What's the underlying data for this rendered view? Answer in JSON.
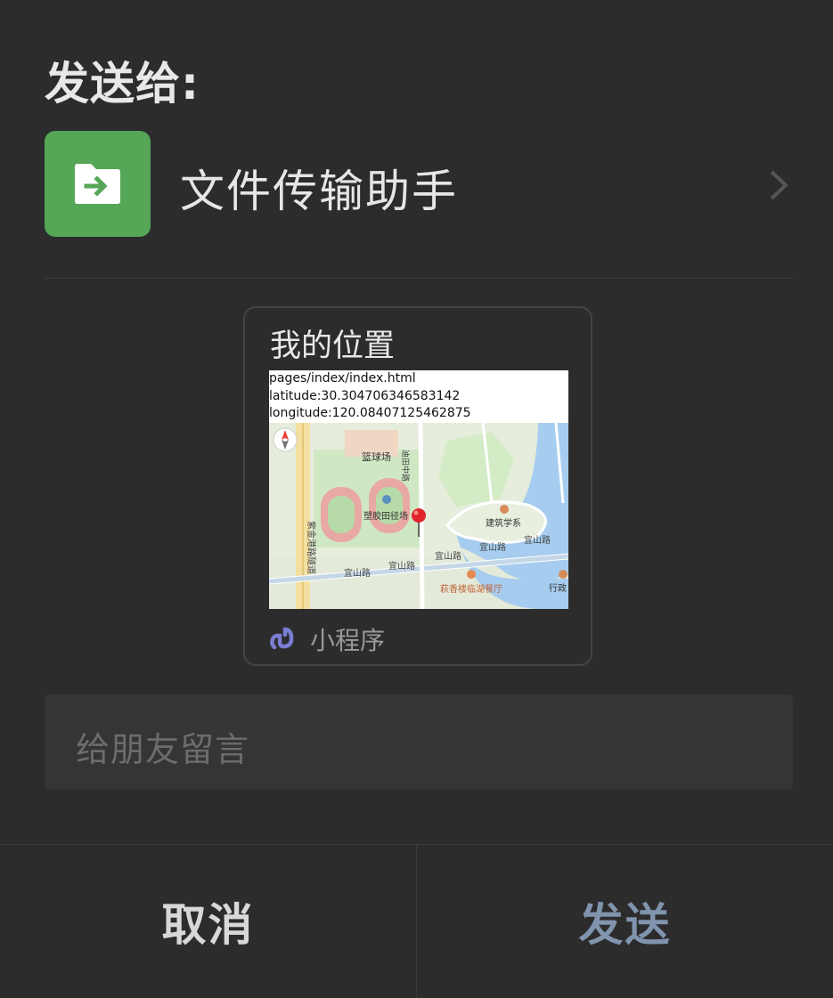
{
  "header": {
    "title": "发送给:"
  },
  "contact": {
    "name": "文件传输助手",
    "icon": "folder-arrow-icon",
    "avatar_color": "#55a656"
  },
  "card": {
    "title": "我的位置",
    "preview_lines": [
      "pages/index/index.html",
      "latitude:30.304706346583142",
      "longitude:120.08407125462875"
    ],
    "map_labels": {
      "basketball": "篮球场",
      "track": "塑胶田径场",
      "architecture": "建筑学系",
      "restaurant": "萩香楼临湖餐厅",
      "road_yishan_1": "宜山路",
      "road_yishan_2": "宜山路",
      "road_yishan_3": "宜山路",
      "road_yishan_4": "宜山路",
      "road_yishan_5": "宜山路",
      "admin": "行政",
      "zijin": "紫金港路隧道",
      "vertical_road": "迪田中路"
    },
    "footer_label": "小程序",
    "footer_icon": "mini-program-icon"
  },
  "message": {
    "placeholder": "给朋友留言"
  },
  "buttons": {
    "cancel": "取消",
    "send": "发送"
  },
  "colors": {
    "send": "#8094ad",
    "background": "#2c2c2c"
  }
}
